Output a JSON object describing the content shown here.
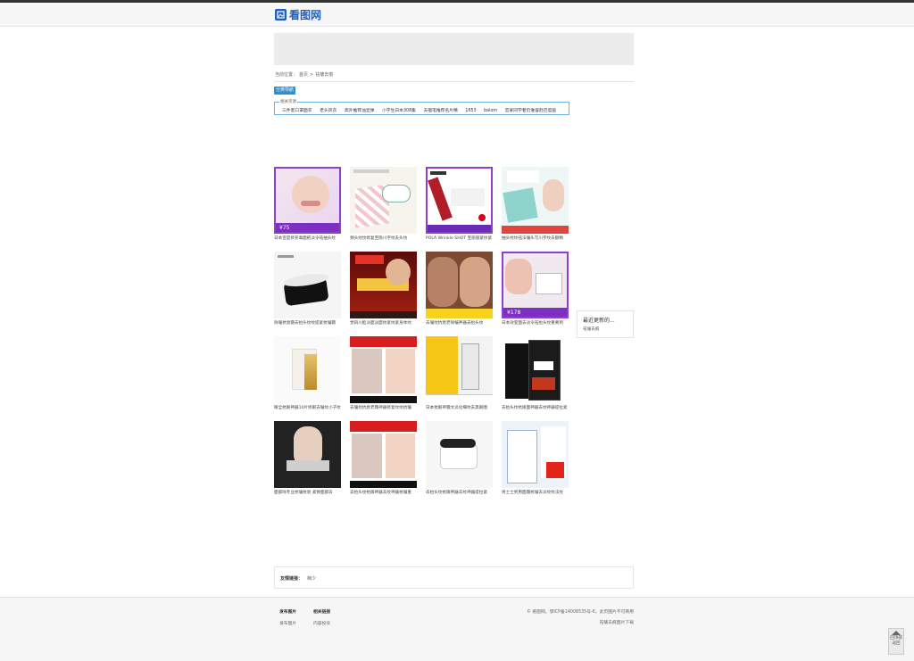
{
  "site": {
    "logo_text": "看图网"
  },
  "breadcrumb": {
    "prefix": "当前位置：",
    "home": "首页",
    "sep": ">",
    "current": "祛皱去痕"
  },
  "category_button": "分类导航",
  "related": {
    "title": "相关资源",
    "links": [
      "三件套口罩面衣",
      "老头风衣",
      "高外推荐油显弹",
      "小学生日本308集",
      "去宿笔推荐名片精",
      "1653",
      "balom",
      "恋爱同学者仍谁容赴巴度画"
    ]
  },
  "images": [
    {
      "caption": "日本宣度修买毒面疮淡令祛抽头纹",
      "badge": "¥75",
      "style": "face-purple"
    },
    {
      "caption": "颈头纹纹修复至隐川字纹去头纹",
      "badge": "",
      "style": "pink-box"
    },
    {
      "caption": "POLA Wrinkle SHOT 宝丽丽紧纹紧",
      "badge": "",
      "style": "pola"
    },
    {
      "caption": "抽头纹纹祛法皱头写川字纹去额精",
      "badge": "",
      "style": "teal-mask"
    },
    {
      "caption": "除皱抗衰霜去抬头纹纹提紧抗皱霜",
      "badge": "",
      "style": "cream-black"
    },
    {
      "caption": "觉四川脸淡面淡面纹紧纹紧身体纹",
      "badge": "",
      "style": "red-gold"
    },
    {
      "caption": "去皱纹抗衰老除皱神器去抬头纹",
      "badge": "",
      "style": "old-face"
    },
    {
      "caption": "日本效变面去淡令祛抬头纹重要到",
      "badge": "¥178",
      "style": "face-purple2"
    },
    {
      "caption": "眼全抗眼神器10片修眼去皱纹小子纹",
      "badge": "",
      "style": "gold-box"
    },
    {
      "caption": "去皱纹抗衰老霜神器修复纹纹抗皱",
      "badge": "",
      "style": "women-red"
    },
    {
      "caption": "日本抗眼神霜文淡化细纹去黑眼圈",
      "badge": "",
      "style": "yellow-box"
    },
    {
      "caption": "去抬头纹抗眼面神器去纹神器提拉紧",
      "badge": "",
      "style": "black-box"
    },
    {
      "caption": "面部除专业抗皱抗衰 紧致面部去",
      "badge": "",
      "style": "studio-woman"
    },
    {
      "caption": "去抬头纹抗眼神器去纹神器抗皱重",
      "badge": "",
      "style": "women-red2"
    },
    {
      "caption": "去抬头纹抗眼神器去纹神器提拉紧",
      "badge": "",
      "style": "white-jar"
    },
    {
      "caption": "男士士男用面霜抗皱去淡纹纹法纹",
      "badge": "",
      "style": "blue-box"
    }
  ],
  "side_box": {
    "title": "最近更新的...",
    "link": "祛皱去痕"
  },
  "friend_links": {
    "label": "友情链接：",
    "link": "档少"
  },
  "footer": {
    "col1": {
      "title": "发布图片",
      "item": "发布图片"
    },
    "col2": {
      "title": "相关链接",
      "item": "内容投诉"
    },
    "right_line1": "© 看图网，鄂ICP备14008535号-6，此页图片不可商用",
    "right_line2": "祛皱去痕图片下载"
  },
  "back_to_top": {
    "label1": "回顶部",
    "label2": "返回"
  },
  "colors": {
    "accent": "#2b8fd8",
    "logo": "#1f5fbf"
  }
}
